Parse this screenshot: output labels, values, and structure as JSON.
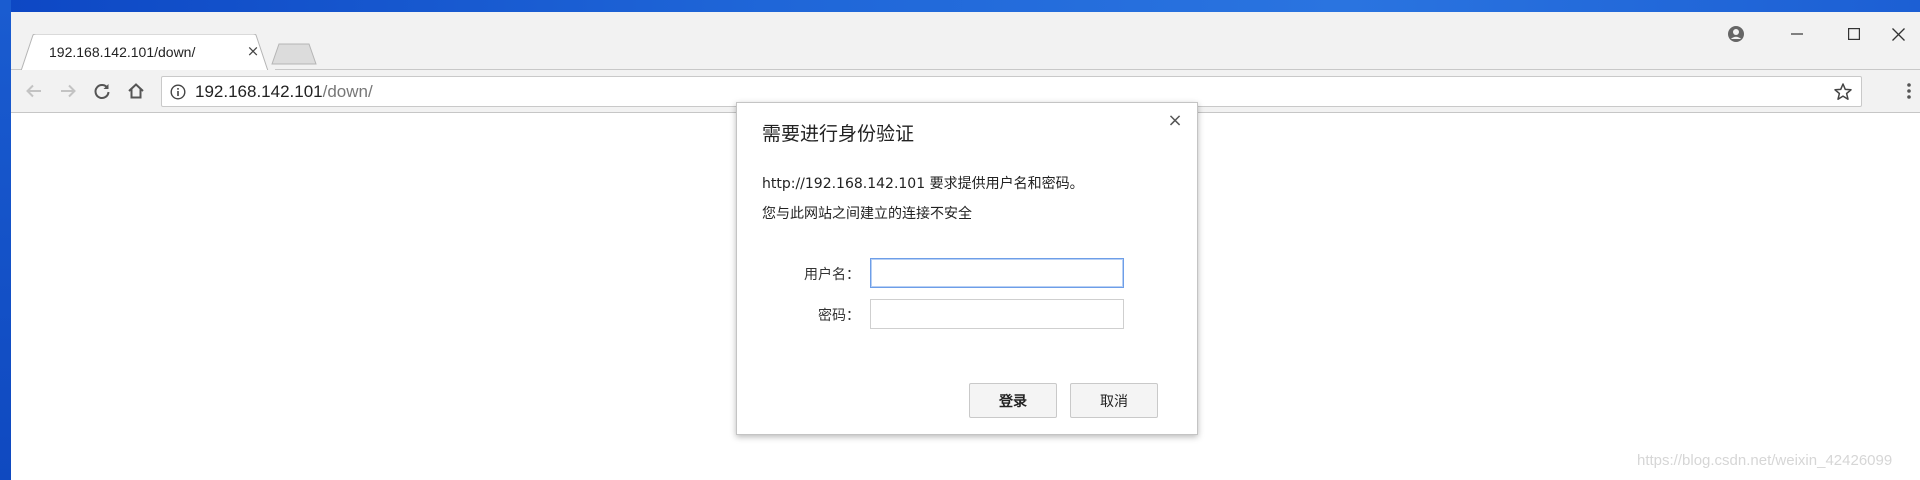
{
  "tab": {
    "title": "192.168.142.101/down/",
    "close_glyph": "×"
  },
  "window_controls": {
    "account_icon": "account-icon",
    "minimize_glyph": "—",
    "maximize_glyph": "☐",
    "close_glyph": "✕"
  },
  "omnibox": {
    "host": "192.168.142.101",
    "path": "/down/"
  },
  "dialog": {
    "title": "需要进行身份验证",
    "message_line1": "http://192.168.142.101 要求提供用户名和密码。",
    "message_line2": "您与此网站之间建立的连接不安全",
    "username_label": "用户名：",
    "password_label": "密码：",
    "username_value": "",
    "password_value": "",
    "login_button": "登录",
    "cancel_button": "取消",
    "close_glyph": "×"
  },
  "watermark": "https://blog.csdn.net/weixin_42426099",
  "colors": {
    "desktop": "#1d5fd1",
    "focus_border": "#6d9ee8"
  }
}
